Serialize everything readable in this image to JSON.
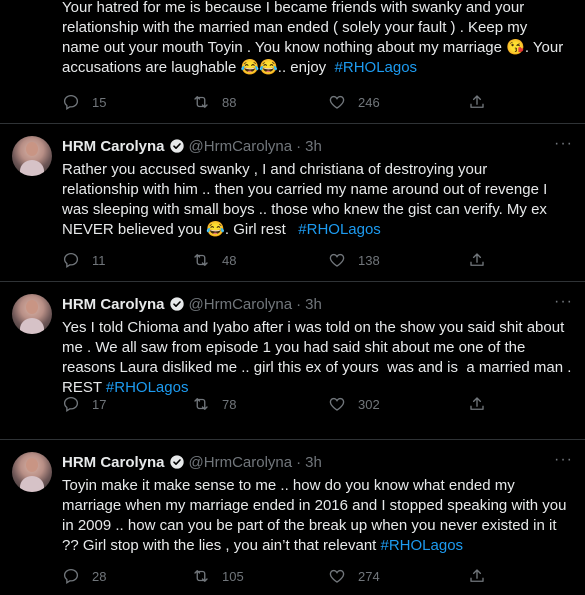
{
  "tweets": [
    {
      "text_parts": [
        "Your hatred for me is because I became friends with swanky and your\nrelationship with the married man ended ( solely your fault ) . Keep my\nname out your mouth Toyin . You know nothing about my marriage 😘. Your\naccusations are laughable 😂😂.. enjoy  ",
        "#RHOLagos"
      ],
      "replies": "15",
      "retweets": "88",
      "likes": "246"
    },
    {
      "name": "HRM Carolyna",
      "handle": "@HrmCarolyna",
      "dot": "·",
      "time": "3h",
      "text_parts": [
        "Rather you accused swanky , I and christiana of destroying your\nrelationship with him .. then you carried my name around out of revenge I\nwas sleeping with small boys .. those who knew the gist can verify. My ex\nNEVER believed you 😂. Girl rest   ",
        "#RHOLagos"
      ],
      "replies": "11",
      "retweets": "48",
      "likes": "138"
    },
    {
      "name": "HRM Carolyna",
      "handle": "@HrmCarolyna",
      "dot": "·",
      "time": "3h",
      "text_parts": [
        "Yes I told Chioma and Iyabo after i was told on the show you said shit about\nme . We all saw from episode 1 you had said shit about me one of the\nreasons Laura disliked me .. girl this ex of yours  was and is  a married man .\nREST ",
        "#RHOLagos"
      ],
      "replies": "17",
      "retweets": "78",
      "likes": "302"
    },
    {
      "name": "HRM Carolyna",
      "handle": "@HrmCarolyna",
      "dot": "·",
      "time": "3h",
      "text_parts": [
        "Toyin make it make sense to me .. how do you know what ended my\nmarriage when my marriage ended in 2016 and I stopped speaking with you\nin 2009 .. how can you be part of the break up when you never existed in it\n?? Girl stop with the lies , you ain’t that relevant ",
        "#RHOLagos"
      ],
      "replies": "28",
      "retweets": "105",
      "likes": "274"
    }
  ],
  "colors": {
    "background": "#000000",
    "text": "#e7e9ea",
    "muted": "#71767b",
    "link": "#1d9bf0",
    "divider": "#2f3336"
  },
  "icons": [
    "verified-badge-icon",
    "more-options-icon",
    "reply-icon",
    "retweet-icon",
    "like-icon",
    "share-icon"
  ]
}
